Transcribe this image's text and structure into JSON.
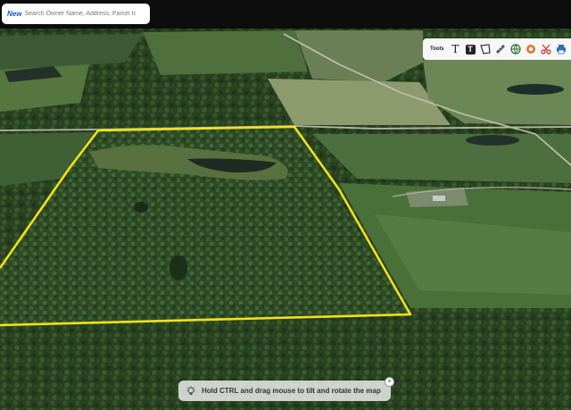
{
  "search": {
    "badge": "New",
    "placeholder": "Search Owner Name, Address, Parcel Id"
  },
  "toolbar": {
    "label": "Tools",
    "text_tool": "T",
    "text_box_tool": "T",
    "items": [
      "text-icon",
      "text-box-icon",
      "polygon-icon",
      "ruler-icon",
      "globe-icon",
      "donut-icon",
      "scissors-icon",
      "printer-icon"
    ]
  },
  "hint": {
    "text": "Hold CTRL and drag mouse to tilt and rotate the map",
    "close": "×"
  },
  "colors": {
    "parcel_outline": "#f2e21a",
    "search_badge": "#1a56c8",
    "topbar": "#0d0d0d"
  }
}
